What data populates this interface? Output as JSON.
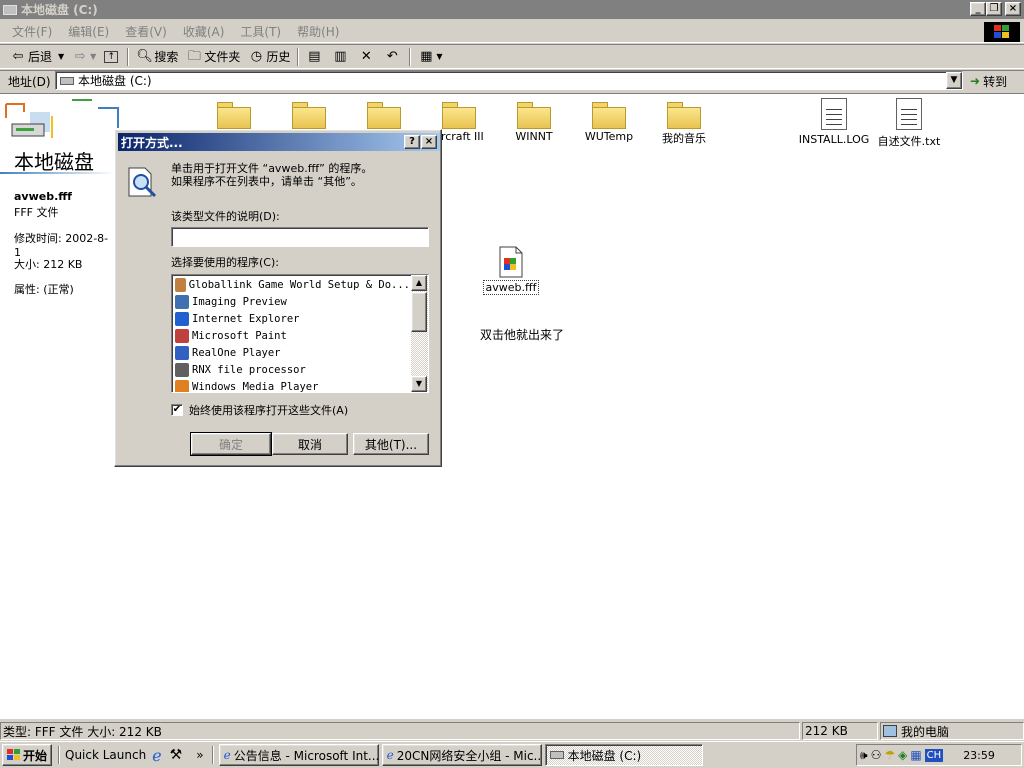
{
  "window": {
    "title": "本地磁盘 (C:)"
  },
  "menu": [
    "文件(F)",
    "编辑(E)",
    "查看(V)",
    "收藏(A)",
    "工具(T)",
    "帮助(H)"
  ],
  "toolbar": {
    "back": "后退",
    "search": "搜索",
    "folders": "文件夹",
    "history": "历史"
  },
  "address": {
    "label": "地址(D)",
    "value": "本地磁盘 (C:)",
    "go": "转到"
  },
  "left_panel": {
    "title": "本地磁盘",
    "filename": "avweb.fff",
    "filetype": "FFF 文件",
    "modified_label": "修改时间:",
    "modified_value": "2002-8-1",
    "size_label": "大小:",
    "size_value": "212 KB",
    "attr_label": "属性:",
    "attr_value": "(正常)"
  },
  "folders": [
    "",
    "",
    "",
    "arcraft III",
    "WINNT",
    "WUTemp",
    "我的音乐"
  ],
  "files": [
    "INSTALL.LOG",
    "自述文件.txt"
  ],
  "selected_file": "avweb.fff",
  "annotation": "双击他就出来了",
  "dialog": {
    "title": "打开方式...",
    "help": "?",
    "close": "×",
    "info_line1": "单击用于打开文件 “avweb.fff” 的程序。",
    "info_line2": "如果程序不在列表中，请单击 “其他”。",
    "desc_label": "该类型文件的说明(D):",
    "desc_value": "",
    "program_label": "选择要使用的程序(C):",
    "programs": [
      {
        "name": "Globallink Game World Setup & Do...",
        "color": "#c08040"
      },
      {
        "name": "Imaging Preview",
        "color": "#4070b0"
      },
      {
        "name": "Internet Explorer",
        "color": "#2060d0"
      },
      {
        "name": "Microsoft Paint",
        "color": "#c04040"
      },
      {
        "name": "RealOne Player",
        "color": "#3060c0"
      },
      {
        "name": "RNX file processor",
        "color": "#606060"
      },
      {
        "name": "Windows Media Player",
        "color": "#e08020"
      }
    ],
    "always_use": "始终使用该程序打开这些文件(A)",
    "ok": "确定",
    "cancel": "取消",
    "other": "其他(T)..."
  },
  "status": {
    "left": "类型: FFF 文件 大小: 212 KB",
    "size": "212 KB",
    "zone": "我的电脑"
  },
  "taskbar": {
    "start": "开始",
    "quick_launch": "Quick Launch",
    "more": "»",
    "tasks": [
      "公告信息 - Microsoft Int...",
      "20CN网络安全小组 - Mic...",
      "本地磁盘 (C:)"
    ],
    "ime": "CH",
    "clock": "23:59"
  }
}
